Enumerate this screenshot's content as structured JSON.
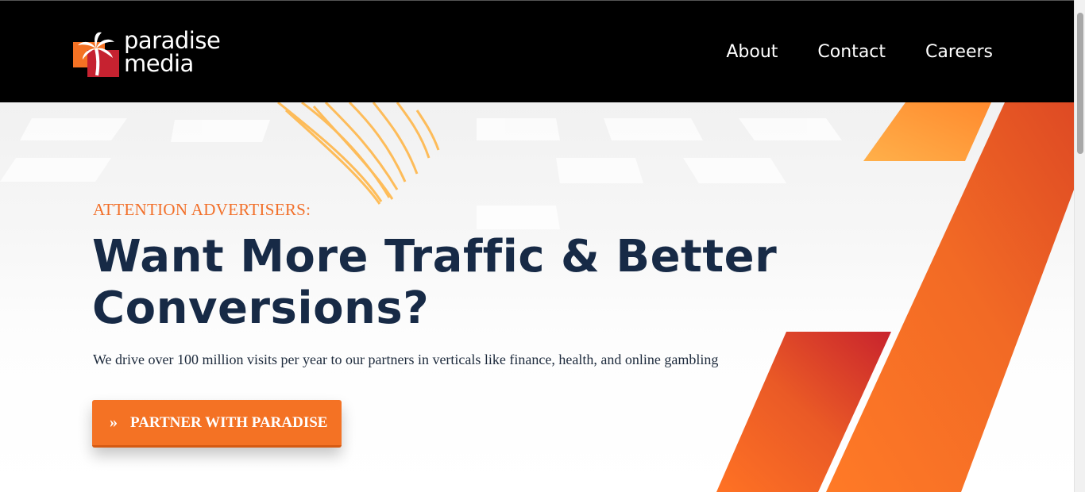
{
  "header": {
    "logo": {
      "line1": "paradise",
      "line2": "media"
    },
    "nav": [
      {
        "label": "About"
      },
      {
        "label": "Contact"
      },
      {
        "label": "Careers"
      }
    ]
  },
  "hero": {
    "eyebrow": "ATTENTION ADVERTISERS:",
    "headline_line1": "Want More Traffic & Better",
    "headline_line2": "Conversions?",
    "lead": "We drive over 100 million visits per year to our partners in verticals like finance, health, and online gambling",
    "cta": {
      "label": "PARTNER WITH PARADISE",
      "icon": "double-chevron-right-icon"
    }
  },
  "colors": {
    "topbar": "#000000",
    "accent": "#f47224",
    "headline": "#172a46",
    "eyebrow": "#f2702a"
  }
}
